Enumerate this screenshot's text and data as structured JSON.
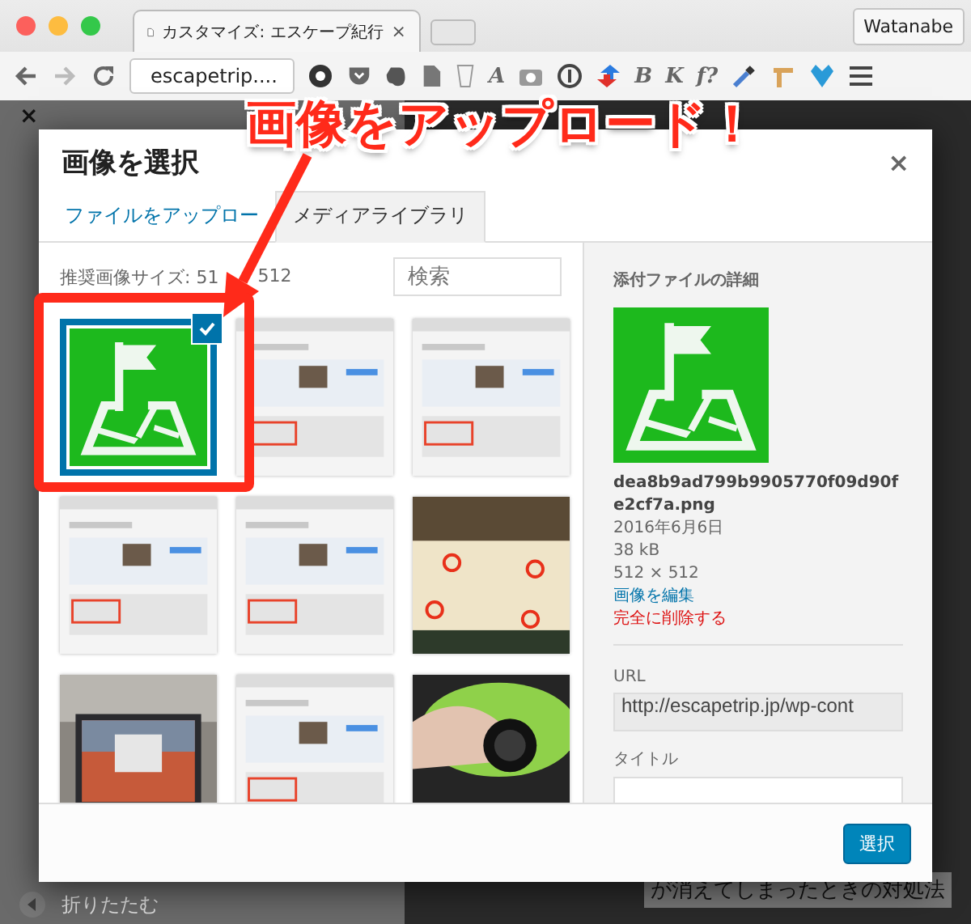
{
  "browser": {
    "tab_title": "カスタマイズ: エスケープ紀行",
    "tab_close": "×",
    "profile": "Watanabe",
    "address": "escapetrip....",
    "extensions": [
      {
        "kind": "gear"
      },
      {
        "kind": "pocket"
      },
      {
        "kind": "blob"
      },
      {
        "kind": "document"
      },
      {
        "kind": "cup"
      },
      {
        "kind": "text",
        "label": "A"
      },
      {
        "kind": "camera"
      },
      {
        "kind": "info"
      },
      {
        "kind": "arrows"
      },
      {
        "kind": "text",
        "label": "B"
      },
      {
        "kind": "text",
        "label": "K"
      },
      {
        "kind": "text",
        "label": "f?"
      },
      {
        "kind": "dropper"
      },
      {
        "kind": "tool"
      },
      {
        "kind": "heart"
      }
    ]
  },
  "background": {
    "close": "×",
    "collapse": "折りたたむ",
    "caption": "が消えてしまったときの対処法"
  },
  "annotation": {
    "text": "画像をアップロード！"
  },
  "modal": {
    "title": "画像を選択",
    "close": "×",
    "tabs": [
      {
        "label": "ファイルをアップロー",
        "selected": false
      },
      {
        "label": "メディアライブラリ",
        "selected": true
      }
    ],
    "hint": "推奨画像サイズ: 51",
    "hint_end": "512",
    "search": {
      "placeholder": "検索"
    },
    "thumbnails": [
      {
        "kind": "icon",
        "selected": true
      },
      {
        "kind": "screenshot",
        "selected": false
      },
      {
        "kind": "screenshot",
        "selected": false
      },
      {
        "kind": "screenshot",
        "selected": false
      },
      {
        "kind": "screenshot",
        "selected": false
      },
      {
        "kind": "keyboard",
        "selected": false
      },
      {
        "kind": "laptop",
        "selected": false
      },
      {
        "kind": "screenshot",
        "selected": false
      },
      {
        "kind": "bag",
        "selected": false
      }
    ],
    "details": {
      "heading": "添付ファイルの詳細",
      "filename": "dea8b9ad799b9905770f09d90fe2cf7a.png",
      "date": "2016年6月6日",
      "size": "38 kB",
      "dimensions": "512 × 512",
      "edit": "画像を編集",
      "delete": "完全に削除する",
      "url_label": "URL",
      "url": "http://escapetrip.jp/wp-cont",
      "title_label": "タイトル"
    },
    "button": "選択"
  }
}
